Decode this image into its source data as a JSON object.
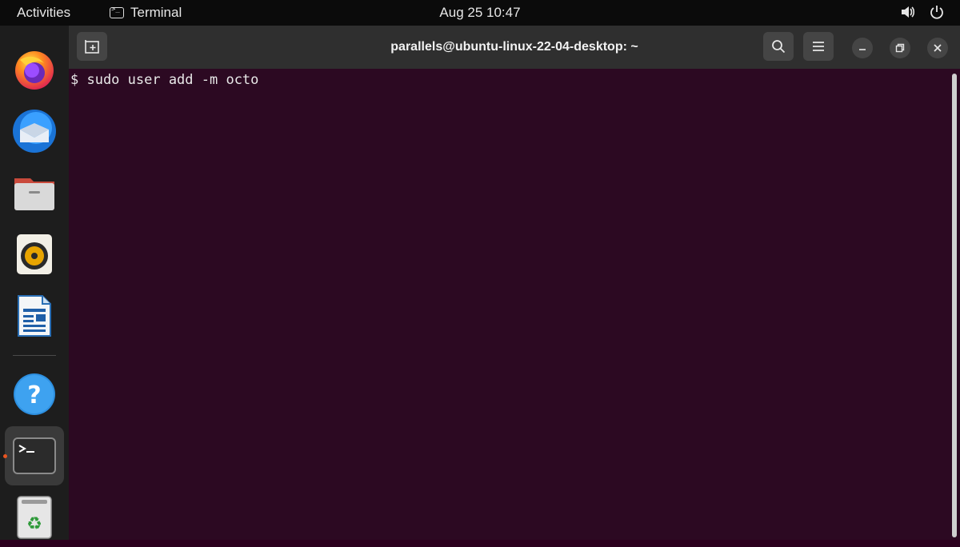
{
  "topbar": {
    "activities": "Activities",
    "app_name": "Terminal",
    "clock": "Aug 25  10:47"
  },
  "dock": {
    "items": [
      {
        "name": "firefox",
        "icon": "firefox-icon"
      },
      {
        "name": "thunderbird",
        "icon": "thunderbird-icon"
      },
      {
        "name": "files",
        "icon": "files-icon"
      },
      {
        "name": "rhythmbox",
        "icon": "rhythmbox-icon"
      },
      {
        "name": "libreoffice-writer",
        "icon": "writer-icon"
      },
      {
        "name": "help",
        "icon": "help-icon"
      },
      {
        "name": "terminal",
        "icon": "terminal-icon",
        "active": true
      },
      {
        "name": "trash",
        "icon": "trash-icon"
      }
    ]
  },
  "terminal": {
    "title": "parallels@ubuntu-linux-22-04-desktop: ~",
    "command_line": "$ sudo user add -m octo"
  },
  "colors": {
    "terminal_bg": "#2c0922",
    "header_bg": "#2f2f2f",
    "accent": "#e95420"
  }
}
